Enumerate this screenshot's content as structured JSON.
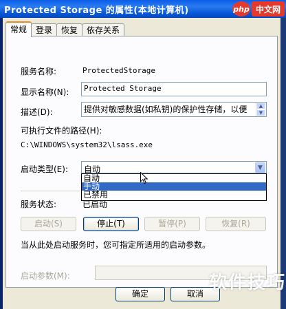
{
  "window": {
    "title": "Protected Storage 的属性(本地计算机)"
  },
  "brand": {
    "php": "php",
    "zw": "中文网",
    "watermark": "软件技巧"
  },
  "tabs": [
    {
      "label": "常规"
    },
    {
      "label": "登录"
    },
    {
      "label": "恢复"
    },
    {
      "label": "依存关系"
    }
  ],
  "general": {
    "service_name_label": "服务名称:",
    "service_name_value": "ProtectedStorage",
    "display_name_label": "显示名称(N):",
    "display_name_value": "Protected Storage",
    "description_label": "描述(D):",
    "description_value": "提供对敏感数据(如私钥)的保护性存储，以便",
    "exe_path_label": "可执行文件的路径(H):",
    "exe_path_value": "C:\\WINDOWS\\system32\\lsass.exe",
    "startup_type_label": "启动类型(E):",
    "startup_type_value": "自动",
    "startup_options": [
      "自动",
      "手动",
      "已禁用"
    ],
    "selected_option_index": 1,
    "service_status_label": "服务状态:",
    "service_status_value": "已启动",
    "buttons": {
      "start": "启动(S)",
      "stop": "停止(T)",
      "pause": "暂停(P)",
      "resume": "恢复(R)"
    },
    "hint": "当从此处启动服务时，您可指定所适用的启动参数。",
    "start_params_label": "启动参数(M):",
    "start_params_value": ""
  },
  "footer": {
    "ok": "确定",
    "cancel": "取消"
  },
  "colors": {
    "title_bar": "#0a5de8",
    "dialog_bg": "#ece9d8",
    "selection": "#316ac5"
  }
}
